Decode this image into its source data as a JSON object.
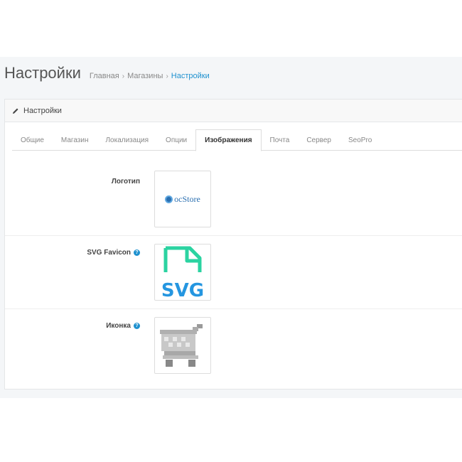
{
  "page": {
    "title": "Настройки",
    "breadcrumb": [
      {
        "label": "Главная"
      },
      {
        "label": "Магазины"
      },
      {
        "label": "Настройки"
      }
    ]
  },
  "panel": {
    "heading": "Настройки",
    "heading_icon": "pencil-icon"
  },
  "tabs": [
    {
      "label": "Общие",
      "active": false
    },
    {
      "label": "Магазин",
      "active": false
    },
    {
      "label": "Локализация",
      "active": false
    },
    {
      "label": "Опции",
      "active": false
    },
    {
      "label": "Изображения",
      "active": true
    },
    {
      "label": "Почта",
      "active": false
    },
    {
      "label": "Сервер",
      "active": false
    },
    {
      "label": "SeoPro",
      "active": false
    }
  ],
  "fields": {
    "logo": {
      "label": "Логотип",
      "image_text": "ocStore"
    },
    "svg_favicon": {
      "label": "SVG Favicon",
      "image_text": "SVG",
      "help_icon": "question-circle-icon"
    },
    "icon": {
      "label": "Иконка",
      "help_icon": "question-circle-icon",
      "image": "shopping-cart-icon"
    }
  },
  "colors": {
    "accent": "#1e91cf",
    "svg_green": "#2bd3a1",
    "svg_blue": "#2596e0"
  }
}
